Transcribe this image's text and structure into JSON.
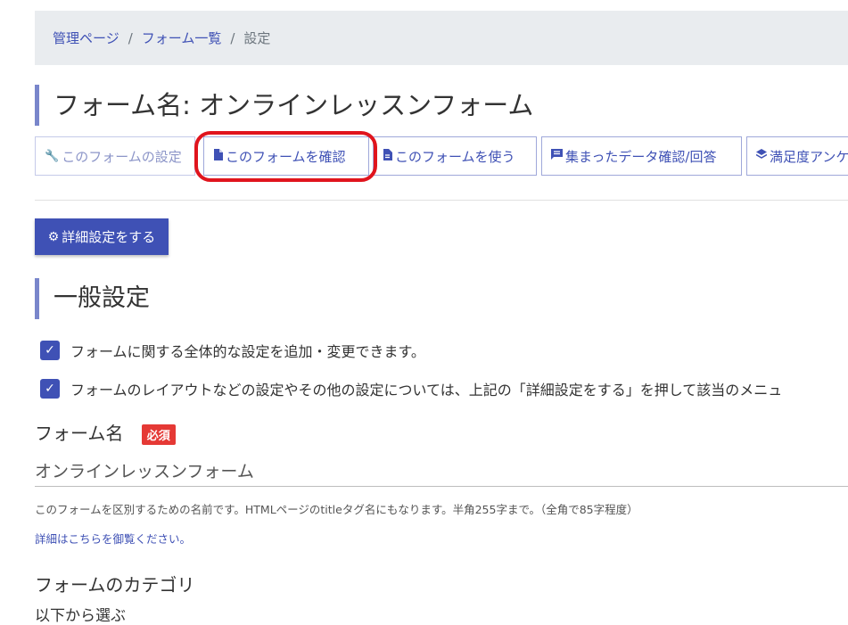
{
  "breadcrumb": {
    "items": [
      "管理ページ",
      "フォーム一覧"
    ],
    "separator": "/",
    "current": "設定"
  },
  "page_title": "フォーム名: オンラインレッスンフォーム",
  "tabs": [
    {
      "label": "このフォームの設定",
      "icon": "wrench-icon"
    },
    {
      "label": "このフォームを確認",
      "icon": "document-icon"
    },
    {
      "label": "このフォームを使う",
      "icon": "document-text-icon"
    },
    {
      "label": "集まったデータ確認/回答",
      "icon": "message-icon"
    },
    {
      "label": "満足度アンケ",
      "icon": "layers-icon"
    }
  ],
  "detail_button": {
    "label": "詳細設定をする",
    "icon": "gear-icon"
  },
  "section_title": "一般設定",
  "checks": [
    "フォームに関する全体的な設定を追加・変更できます。",
    "フォームのレイアウトなどの設定やその他の設定については、上記の「詳細設定をする」を押して該当のメニュ"
  ],
  "form_name": {
    "label": "フォーム名",
    "required": "必須",
    "value": "オンラインレッスンフォーム",
    "help": "このフォームを区別するための名前です。HTMLページのtitleタグ名にもなります。半角255字まで。（全角で85字程度）",
    "link": "詳細はこちらを御覧ください。"
  },
  "category": {
    "label": "フォームのカテゴリ",
    "select_label": "以下から選ぶ"
  },
  "colors": {
    "accent": "#3f51b5",
    "highlight": "#e0141d",
    "required": "#e53935"
  }
}
